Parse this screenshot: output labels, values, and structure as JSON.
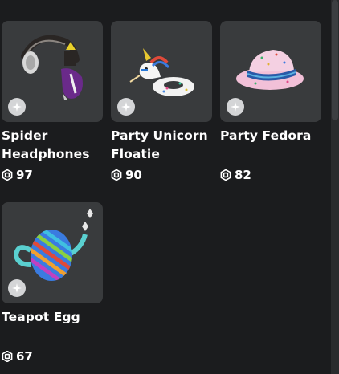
{
  "items": [
    {
      "name": "Spider Headphones",
      "price": "97"
    },
    {
      "name": "Party Unicorn Floatie",
      "price": "90"
    },
    {
      "name": "Party Fedora",
      "price": "82"
    },
    {
      "name": "Teapot Egg",
      "price": "67"
    }
  ],
  "icons": {
    "badge": "sparkle-icon",
    "currency": "robux-icon"
  },
  "colors": {
    "background": "#1b1c1e",
    "card": "#393b3d",
    "text": "#ffffff",
    "badge": "#d4d5d7"
  }
}
